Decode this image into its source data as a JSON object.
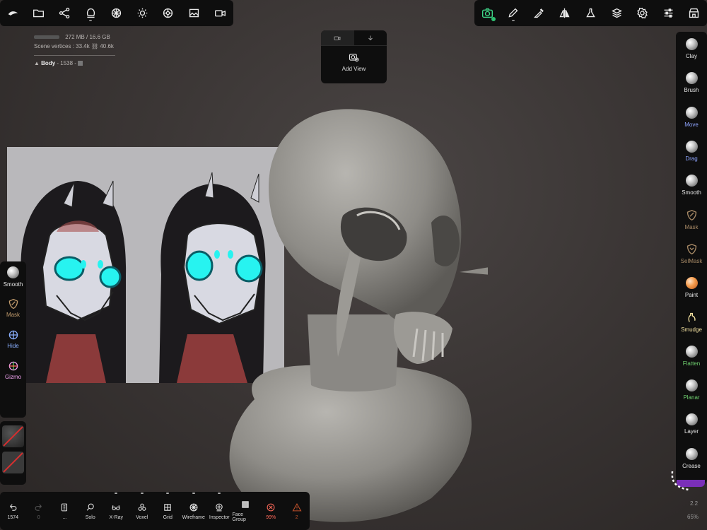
{
  "top_left_toolbar": {
    "icons": [
      "nomad-logo-icon",
      "folder-icon",
      "share-nodes-icon",
      "scene-icon",
      "mesh-icon",
      "light-sun-icon",
      "material-icon",
      "image-icon",
      "video-camera-icon"
    ]
  },
  "top_right_toolbar": {
    "icons": [
      "camera-icon",
      "pen-icon",
      "dropper-icon",
      "symmetry-icon",
      "flask-icon",
      "layers-icon",
      "settings-gear-icon",
      "sliders-icon",
      "store-icon"
    ]
  },
  "scene_info": {
    "memory": "272 MB / 16.6 GB",
    "vertices_label": "Scene vertices :",
    "vertices": "33.4k",
    "vertices_secondary": "40.6k",
    "object_name": "Body",
    "object_info": "- 1538 -"
  },
  "view_panel": {
    "add_view_label": "Add View"
  },
  "left_tools": [
    {
      "label": "Smooth",
      "color": "#e8e8e8",
      "icon": "smooth-icon"
    },
    {
      "label": "Mask",
      "color": "#c19b6c",
      "icon": "mask-shield-icon"
    },
    {
      "label": "Hide",
      "color": "#8ab0ff",
      "icon": "hide-icon"
    },
    {
      "label": "Gizmo",
      "color": "#f1a3f0",
      "icon": "gizmo-icon"
    }
  ],
  "bottom_bar": {
    "undo_count": "1574",
    "redo_count": "0",
    "items": [
      {
        "label": "...",
        "icon": "document-icon"
      },
      {
        "label": "Solo",
        "icon": "magnifier-icon"
      },
      {
        "label": "X-Ray",
        "icon": "glasses-icon"
      },
      {
        "label": "Voxel",
        "icon": "voxel-icon"
      },
      {
        "label": "Grid",
        "icon": "grid-icon"
      },
      {
        "label": "Wireframe",
        "icon": "wireframe-icon"
      },
      {
        "label": "Inspector",
        "icon": "inspector-icon"
      },
      {
        "label": "Face Group",
        "icon": "face-group-icon"
      },
      {
        "label": "99%",
        "icon": "error-circle-icon"
      },
      {
        "label": "2",
        "icon": "warning-triangle-icon"
      }
    ]
  },
  "right_tools": [
    {
      "label": "Clay",
      "color": "#e8e8e8"
    },
    {
      "label": "Brush",
      "color": "#e8e8e8"
    },
    {
      "label": "Move",
      "color": "#8fa5ff"
    },
    {
      "label": "Drag",
      "color": "#8fa5ff"
    },
    {
      "label": "Smooth",
      "color": "#e8e8e8"
    },
    {
      "label": "Mask",
      "color": "#a88a66"
    },
    {
      "label": "SelMask",
      "color": "#a88a66"
    },
    {
      "label": "Paint",
      "color": "#e8e8e8"
    },
    {
      "label": "Smudge",
      "color": "#f3e1a0"
    },
    {
      "label": "Flatten",
      "color": "#6fcf6f"
    },
    {
      "label": "Planar",
      "color": "#6fcf6f"
    },
    {
      "label": "Layer",
      "color": "#e8e8e8"
    },
    {
      "label": "Crease",
      "color": "#e8e8e8"
    }
  ],
  "corner": {
    "version": "2.2",
    "zoom": "65%"
  },
  "colors": {
    "accent_green": "#2fbf71",
    "accent_purple": "#7a2fb8",
    "error_red": "#ff6a5a",
    "warning_orange": "#c0502a"
  }
}
